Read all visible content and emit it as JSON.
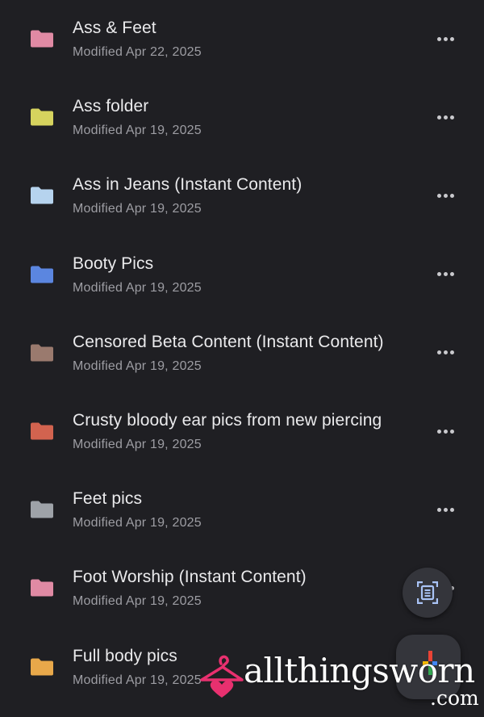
{
  "files": [
    {
      "name": "Ass & Feet",
      "modified": "Modified Apr 22, 2025",
      "color": "#e08aa4"
    },
    {
      "name": "Ass folder",
      "modified": "Modified Apr 19, 2025",
      "color": "#d6d35e"
    },
    {
      "name": "Ass in Jeans (Instant Content)",
      "modified": "Modified Apr 19, 2025",
      "color": "#b6d3ee"
    },
    {
      "name": "Booty Pics",
      "modified": "Modified Apr 19, 2025",
      "color": "#5b86e0"
    },
    {
      "name": "Censored Beta Content (Instant Content)",
      "modified": "Modified Apr 19, 2025",
      "color": "#9a7a6e"
    },
    {
      "name": "Crusty bloody ear pics from new piercing",
      "modified": "Modified Apr 19, 2025",
      "color": "#d2634f"
    },
    {
      "name": "Feet pics",
      "modified": "Modified Apr 19, 2025",
      "color": "#9ea2a8"
    },
    {
      "name": "Foot Worship (Instant Content)",
      "modified": "Modified Apr 19, 2025",
      "color": "#e08aa4"
    },
    {
      "name": "Full body pics",
      "modified": "Modified Apr 19, 2025",
      "color": "#e8a84a"
    }
  ],
  "icons": {
    "more": "more-horizontal-icon",
    "folder": "folder-icon",
    "scan": "document-scan-icon",
    "new": "plus-icon"
  },
  "watermark": {
    "text": "allthingsworn",
    "suffix": ".com",
    "accent": "#e8306f"
  }
}
